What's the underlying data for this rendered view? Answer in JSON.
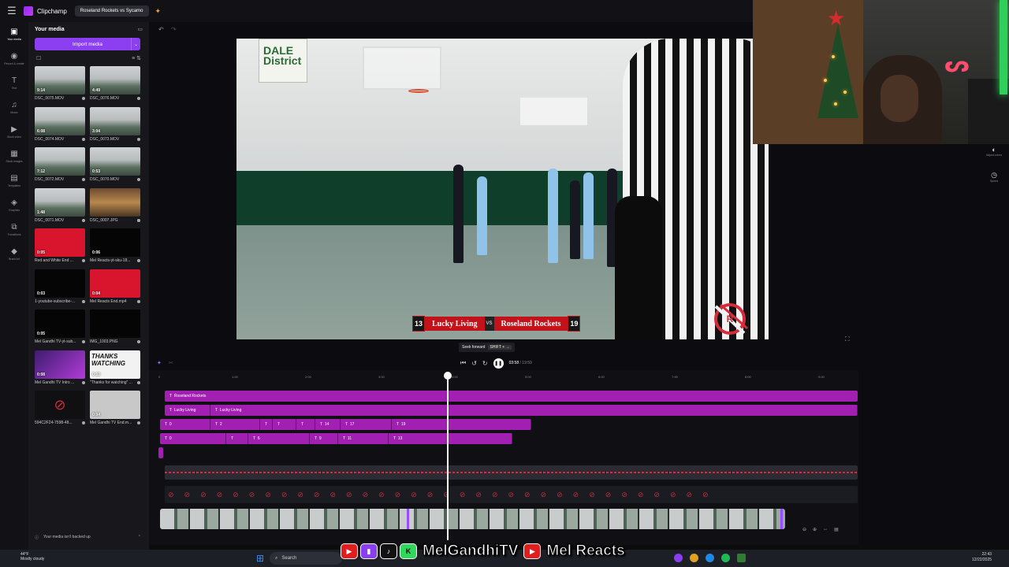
{
  "app": {
    "name": "Clipchamp",
    "project": "Roseland Rockets vs Sycamo"
  },
  "rail": [
    {
      "label": "Your media",
      "icon": "folder-icon"
    },
    {
      "label": "Record & create",
      "icon": "camera-icon"
    },
    {
      "label": "Text",
      "icon": "text-icon"
    },
    {
      "label": "Music",
      "icon": "music-icon"
    },
    {
      "label": "Stock video",
      "icon": "stock-video-icon"
    },
    {
      "label": "Stock images",
      "icon": "stock-images-icon"
    },
    {
      "label": "Templates",
      "icon": "templates-icon"
    },
    {
      "label": "Graphics",
      "icon": "graphics-icon"
    },
    {
      "label": "Transitions",
      "icon": "transitions-icon"
    },
    {
      "label": "Brand kit",
      "icon": "brand-kit-icon"
    }
  ],
  "media": {
    "title": "Your media",
    "import_label": "Import media",
    "backup_notice": "Your media isn't backed up",
    "items": [
      {
        "name": "DSC_0075.MOV",
        "duration": "9:14",
        "kind": "court"
      },
      {
        "name": "DSC_0076.MOV",
        "duration": "4:49",
        "kind": "court"
      },
      {
        "name": "DSC_0074.MOV",
        "duration": "6:08",
        "kind": "court"
      },
      {
        "name": "DSC_0073.MOV",
        "duration": "3:04",
        "kind": "court"
      },
      {
        "name": "DSC_0072.MOV",
        "duration": "7:12",
        "kind": "court"
      },
      {
        "name": "DSC_0070.MOV",
        "duration": "0:53",
        "kind": "court"
      },
      {
        "name": "DSC_0071.MOV",
        "duration": "1:48",
        "kind": "court"
      },
      {
        "name": "DSC_0007.JPG",
        "duration": "",
        "kind": "jpg"
      },
      {
        "name": "Red and White End ...",
        "duration": "0:05",
        "kind": "red"
      },
      {
        "name": "Mel Reacts-yt-sku-18...",
        "duration": "0:06",
        "kind": "black"
      },
      {
        "name": "1-youtube-subscribe-...",
        "duration": "0:03",
        "kind": "black"
      },
      {
        "name": "Mel Reacts End.mp4",
        "duration": "0:04",
        "kind": "red"
      },
      {
        "name": "Mel Gandhi TV-yt-sub...",
        "duration": "0:05",
        "kind": "black"
      },
      {
        "name": "IMG_1003.PNG",
        "duration": "",
        "kind": "black"
      },
      {
        "name": "Mel Gandhi TV Intro ...",
        "duration": "0:08",
        "kind": "intro"
      },
      {
        "name": "\"Thanks for watching\" ...",
        "duration": "0:10",
        "kind": "thanks"
      },
      {
        "name": "594C2F24-7598-48...",
        "duration": "",
        "kind": "logo"
      },
      {
        "name": "Mel Gandhi TV End.m...",
        "duration": "0:04",
        "kind": "gray"
      }
    ],
    "thanks_text": "THANKS WATCHING"
  },
  "preview": {
    "sign_text": "DALE District",
    "scoreboard": {
      "left_score": "13",
      "left_team": "Lucky Living",
      "vs": "VS",
      "right_team": "Roseland Rockets",
      "right_score": "19"
    }
  },
  "playback": {
    "tooltip": "Seek forward",
    "tooltip_key": "SHIFT + →",
    "current": "03:58",
    "total": "/ 19:59"
  },
  "ruler": [
    "0",
    "1:00",
    "2:00",
    "3:00",
    "4:00",
    "5:00",
    "6:00",
    "7:00",
    "8:00",
    "9:00"
  ],
  "tracks": {
    "title_track": "Roseland Rockets",
    "team_track": [
      "Lucky Living",
      "Lucky Living"
    ],
    "score_a": [
      "0",
      "2",
      "",
      "",
      "",
      "14",
      "17",
      "19"
    ],
    "score_b": [
      "0",
      "",
      "6",
      "9",
      "11",
      "13"
    ]
  },
  "right_panel": [
    {
      "label": "Adjust colors",
      "icon": "adjust-colors-icon"
    },
    {
      "label": "Speed",
      "icon": "speed-icon"
    }
  ],
  "taskbar": {
    "temp": "44°F",
    "weather": "Mostly cloudy",
    "search": "Search",
    "time": "22:43",
    "date": "12/22/2025"
  },
  "brand": {
    "name1": "MelGandhiTV",
    "name2": "Mel Reacts"
  }
}
